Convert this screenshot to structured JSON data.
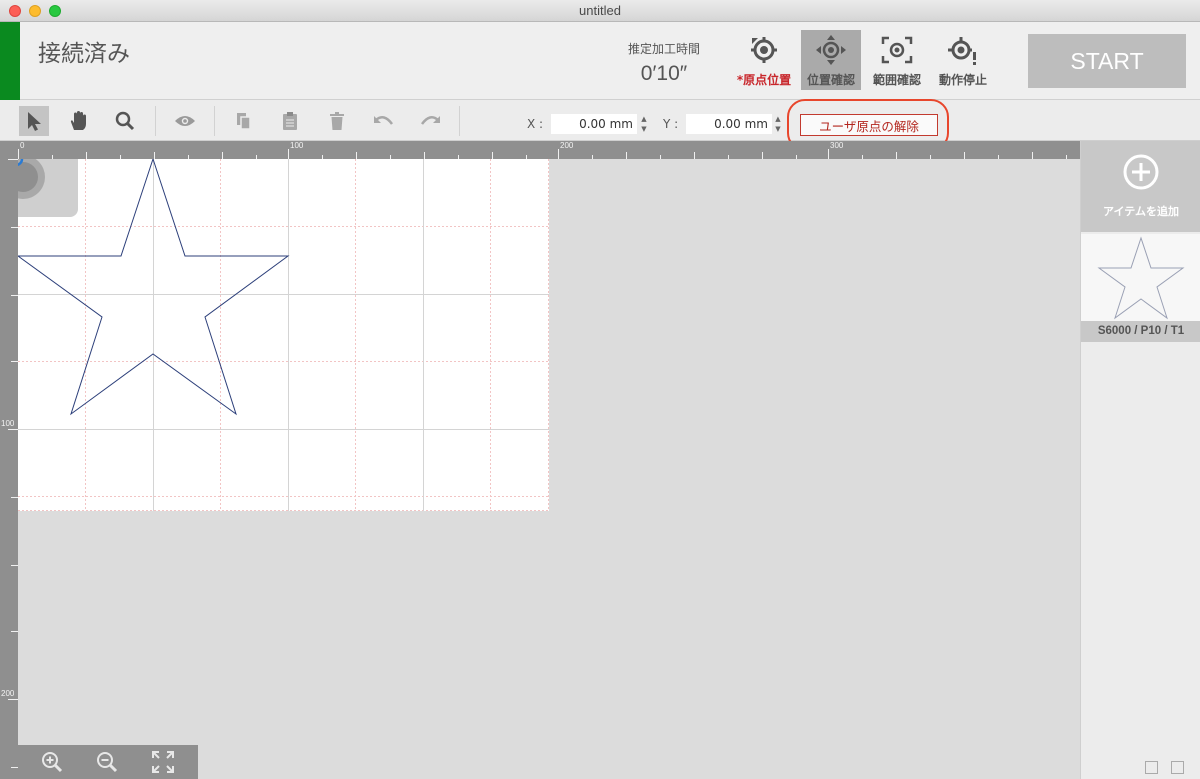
{
  "window": {
    "title": "untitled"
  },
  "header": {
    "connection_status": "接続済み",
    "estimated_time_label": "推定加工時間",
    "estimated_time_value": "0′10″",
    "buttons": [
      {
        "label": "*原点位置",
        "icon": "origin-position-icon",
        "state": "alert"
      },
      {
        "label": "位置確認",
        "icon": "position-check-icon",
        "state": "active"
      },
      {
        "label": "範囲確認",
        "icon": "range-check-icon",
        "state": "normal"
      },
      {
        "label": "動作停止",
        "icon": "stop-operation-icon",
        "state": "normal"
      }
    ],
    "start_label": "START"
  },
  "toolbar": {
    "tools": [
      "select-arrow-icon",
      "hand-pan-icon",
      "zoom-magnifier-icon",
      "eye-preview-icon",
      "copy-icon",
      "paste-icon",
      "trash-icon",
      "undo-icon",
      "redo-icon"
    ],
    "x_label": "X :",
    "x_value": "0.00 mm",
    "y_label": "Y :",
    "y_value": "0.00 mm",
    "reset_origin_label": "ユーザ原点の解除"
  },
  "rulers": {
    "top_labels": [
      "0",
      "100",
      "200",
      "300"
    ],
    "left_labels": [
      "100",
      "200"
    ]
  },
  "right_panel": {
    "add_item_label": "アイテムを追加",
    "items": [
      {
        "label": "S6000 / P10 / T1",
        "shape": "star"
      }
    ]
  },
  "colors": {
    "connected": "#0a8a1f",
    "alert": "#c8262b",
    "highlight": "#e8462c",
    "star_stroke": "#2c3f7a"
  }
}
